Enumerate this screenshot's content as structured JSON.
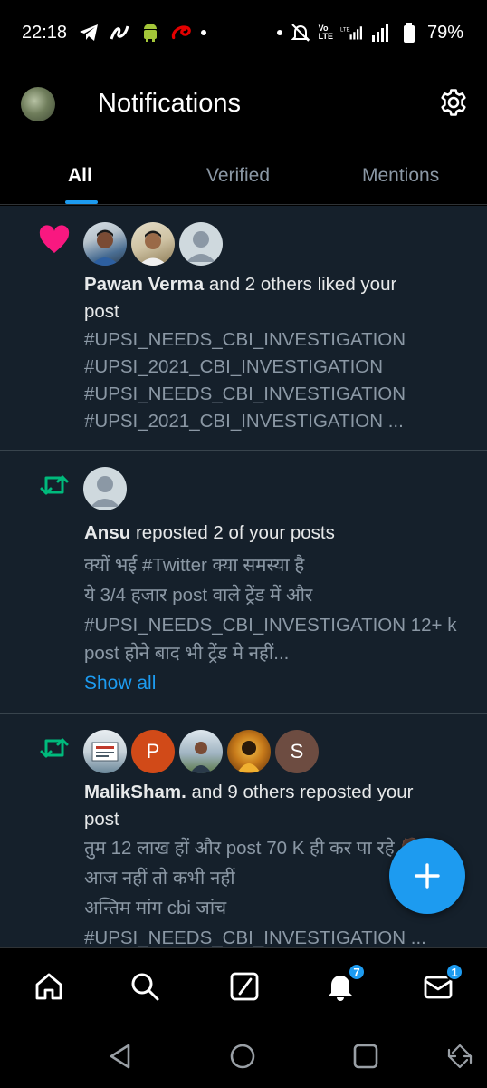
{
  "status_bar": {
    "time": "22:18",
    "battery": "79%",
    "left_icons": [
      "telegram-icon",
      "payment-app-icon",
      "android-icon",
      "airtel-icon"
    ],
    "right_icons": [
      "mute-bell-icon",
      "volte-icon",
      "lte-signal-icon",
      "signal-icon",
      "battery-icon"
    ]
  },
  "header": {
    "title": "Notifications"
  },
  "tabs": [
    {
      "label": "All",
      "active": true
    },
    {
      "label": "Verified",
      "active": false
    },
    {
      "label": "Mentions",
      "active": false
    }
  ],
  "notifications": [
    {
      "type": "like",
      "user": "Pawan Verma",
      "action": " and 2 others liked your",
      "action2": "post",
      "lines": [
        "#UPSI_NEEDS_CBI_INVESTIGATION",
        "#UPSI_2021_CBI_INVESTIGATION",
        "#UPSI_NEEDS_CBI_INVESTIGATION",
        "#UPSI_2021_CBI_INVESTIGATION ..."
      ]
    },
    {
      "type": "repost",
      "user": "Ansu",
      "action": " reposted 2 of your posts",
      "lines": [
        "क्यों भई #Twitter क्या समस्या है",
        "ये 3/4 हजार post वाले ट्रेंड में और",
        "#UPSI_NEEDS_CBI_INVESTIGATION  12+ k",
        "post होने बाद भी ट्रेंड मे नहीं..."
      ],
      "show_all": "Show all"
    },
    {
      "type": "repost",
      "user": "MalikSham.",
      "action": " and 9 others reposted your",
      "action2": "post",
      "avatar_letters": [
        "P",
        "S"
      ],
      "lines": [
        "तुम 12 लाख हों और post 70 K ही कर पा रहे 🧔",
        " आज नहीं तो कभी नहीं",
        "अन्तिम मांग cbi जांच",
        "#UPSI_NEEDS_CBI_INVESTIGATION ..."
      ]
    }
  ],
  "bottom_nav": {
    "items": [
      "home-icon",
      "search-icon",
      "grok-icon",
      "notifications-icon",
      "messages-icon"
    ],
    "notifications_badge": "7",
    "messages_badge": "1"
  },
  "colors": {
    "accent": "#1d9bf0",
    "like": "#f91880",
    "repost": "#00ba7c",
    "feed_bg": "#15202b"
  }
}
